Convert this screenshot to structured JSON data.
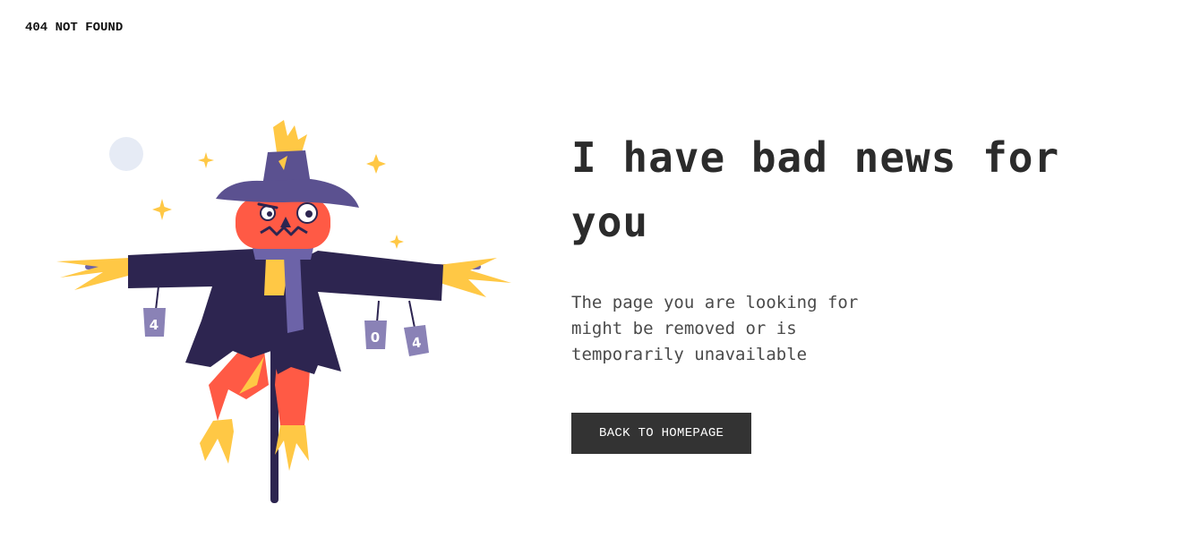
{
  "header": {
    "label": "404 NOT FOUND"
  },
  "main": {
    "headline": "I have bad news for you",
    "description": "The page you are looking for might be removed or is temporarily unavailable",
    "button_label": "BACK TO HOMEPAGE"
  },
  "illustration": {
    "subject": "scarecrow",
    "cans": [
      "4",
      "0",
      "4"
    ],
    "colors": {
      "hat": "#5b5190",
      "coat": "#2d2550",
      "face": "#ff5a45",
      "straw": "#ffc845",
      "scarf": "#6c63a8",
      "moon": "#e6ebf5"
    }
  },
  "colors": {
    "button_bg": "#333333",
    "button_text": "#ffffff",
    "text": "#2b2b2b"
  }
}
